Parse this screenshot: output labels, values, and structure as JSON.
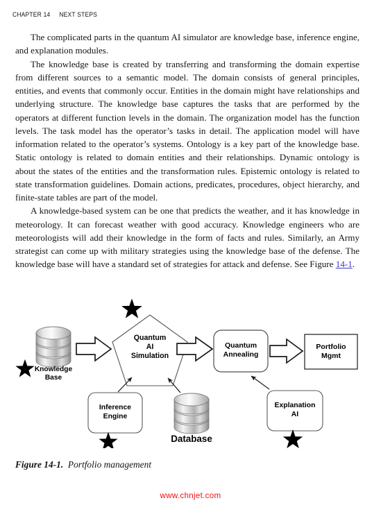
{
  "header": {
    "chapter": "CHAPTER 14",
    "title": "NEXT STEPS"
  },
  "body": {
    "paragraphs": [
      "The complicated parts in the quantum AI simulator are knowledge base, inference engine, and explanation modules.",
      "The knowledge base is created by transferring and transforming the domain expertise from different sources to a semantic model. The domain consists of general principles, entities, and events that commonly occur. Entities in the domain might have relationships and underlying structure. The knowledge base captures the tasks that are performed by the operators at different function levels in the domain. The organization model has the function levels. The task model has the operator’s tasks in detail. The application model will have information related to the operator’s systems. Ontology is a key part of the knowledge base. Static ontology is related to domain entities and their relationships. Dynamic ontology is about the states of the entities and the transformation rules. Epistemic ontology is related to state transformation guidelines. Domain actions, predicates, procedures, object hierarchy, and finite-state tables are part of the model."
    ],
    "paragraph3": {
      "before_link": "A knowledge-based system can be one that predicts the weather, and it has knowledge in meteorology. It can forecast weather with good accuracy. Knowledge engineers who are meteorologists will add their knowledge in the form of facts and rules. Similarly, an Army strategist can come up with military strategies using the knowledge base of the defense. The knowledge base will have a standard set of strategies for attack and defense. See Figure ",
      "link_text": "14-1",
      "after_link": "."
    }
  },
  "figure": {
    "caption_number": "Figure 14-1.",
    "caption_text": "Portfolio management",
    "nodes": {
      "knowledge_base": {
        "label_line1": "Knowledge",
        "label_line2": "Base",
        "shape": "cylinder"
      },
      "quantum_ai_simulation": {
        "label_line1": "Quantum",
        "label_line2": "AI",
        "label_line3": "Simulation",
        "shape": "pentagon"
      },
      "quantum_annealing": {
        "label_line1": "Quantum",
        "label_line2": "Annealing",
        "shape": "rounded-rect"
      },
      "portfolio_mgmt": {
        "label_line1": "Portfolio",
        "label_line2": "Mgmt",
        "shape": "rect"
      },
      "inference_engine": {
        "label_line1": "Inference",
        "label_line2": "Engine",
        "shape": "rounded-rect"
      },
      "database": {
        "label_line1": "Database",
        "shape": "cylinder"
      },
      "explanation_ai": {
        "label_line1": "Explanation",
        "label_line2": "AI",
        "shape": "rounded-rect"
      }
    },
    "star_markers": 4,
    "colors": {
      "stroke": "#1a1a1a",
      "fill": "#ffffff",
      "star": "#000000",
      "cylinder_light": "#f2f2f2",
      "cylinder_dark": "#8d8d8d"
    }
  },
  "watermark": {
    "text": "www.chnjet.com",
    "color": "#ee1111"
  }
}
